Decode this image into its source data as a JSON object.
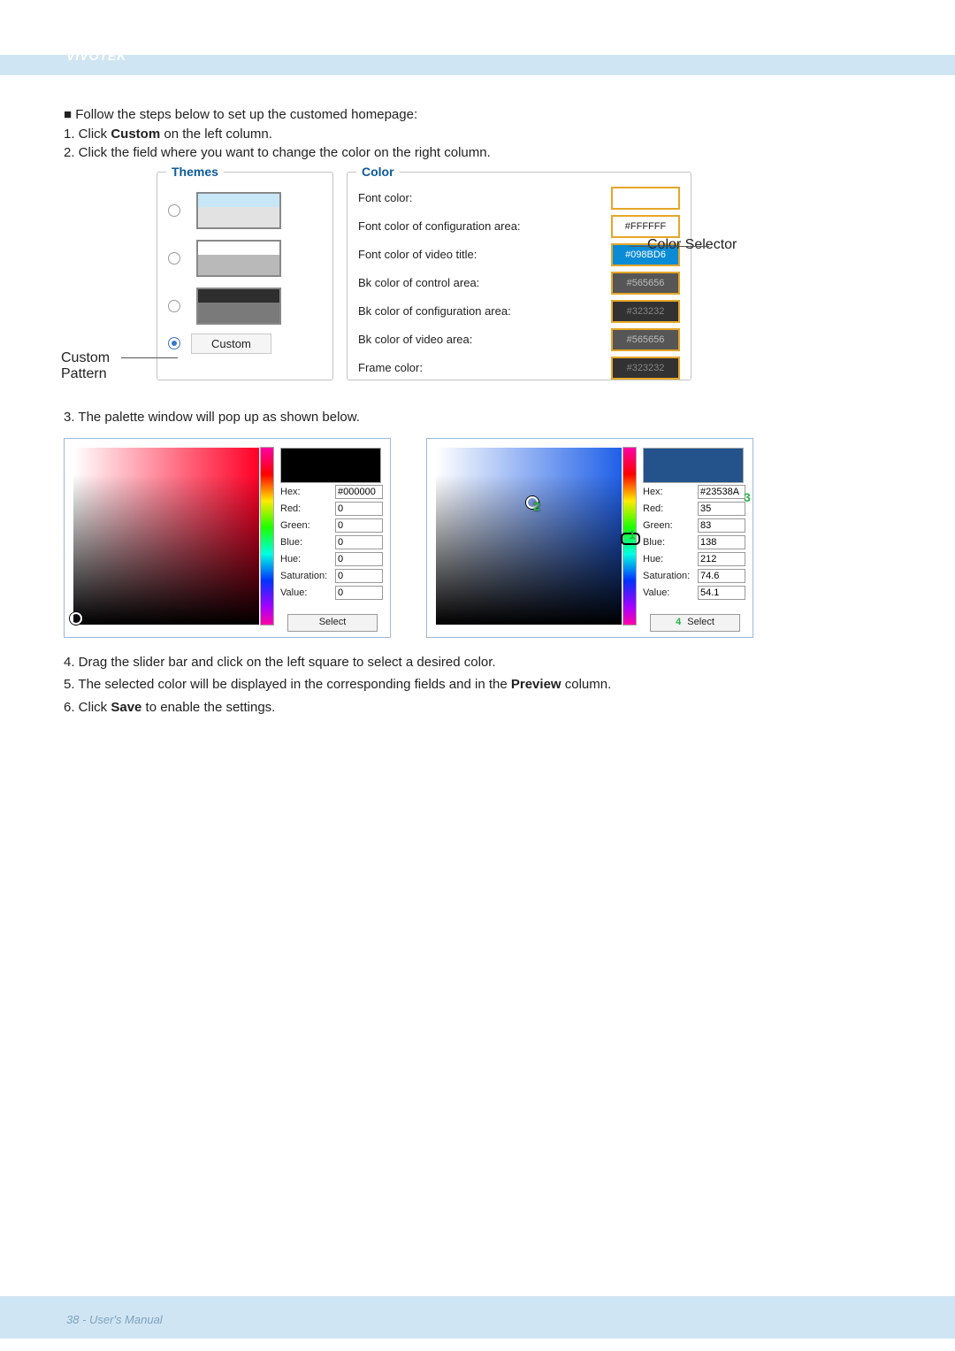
{
  "brand": "VIVOTEK",
  "intro": {
    "bullet": "■ Follow the steps below to set up the customed homepage:",
    "step1_pre": "1. Click ",
    "step1_bold": "Custom",
    "step1_post": " on the left column.",
    "step2": "2. Click the field where you want to change the color on the right column."
  },
  "themes": {
    "title": "Themes",
    "custom_label": "Custom",
    "options": [
      {
        "top": "#c7e7f6",
        "bot": "#e2e2e2"
      },
      {
        "top": "#ffffff",
        "bot": "#b9b9b9"
      },
      {
        "top": "#2e2e2e",
        "bot": "#7a7a7a"
      }
    ]
  },
  "colors": {
    "title": "Color",
    "rows": [
      {
        "lbl": "Font color:",
        "val": "",
        "cls": "empty"
      },
      {
        "lbl": "Font color of configuration area:",
        "val": "#FFFFFF",
        "cls": "white"
      },
      {
        "lbl": "Font color of video title:",
        "val": "#098BD6",
        "cls": "teal"
      },
      {
        "lbl": "Bk color of control area:",
        "val": "#565656",
        "cls": "dk1"
      },
      {
        "lbl": "Bk color of configuration area:",
        "val": "#323232",
        "cls": "dk2"
      },
      {
        "lbl": "Bk color of video area:",
        "val": "#565656",
        "cls": "dk1"
      },
      {
        "lbl": "Frame color:",
        "val": "#323232",
        "cls": "dk2"
      }
    ]
  },
  "annotations": {
    "custom_pattern": "Custom Pattern",
    "color_selector": "Color Selector"
  },
  "step3": "3. The palette window will pop up as shown below.",
  "palette_labels": {
    "hex": "Hex:",
    "red": "Red:",
    "green": "Green:",
    "blue": "Blue:",
    "hue": "Hue:",
    "sat": "Saturation:",
    "val": "Value:",
    "select": "Select"
  },
  "paletteA": {
    "hex": "#000000",
    "red": "0",
    "green": "0",
    "blue": "0",
    "hue": "0",
    "sat": "0",
    "val": "0"
  },
  "paletteB": {
    "hex": "#23538A",
    "red": "35",
    "green": "83",
    "blue": "138",
    "hue": "212",
    "sat": "74.6",
    "val": "54.1"
  },
  "markers": {
    "m1": "1",
    "m2": "2",
    "m3": "3",
    "m4": "4"
  },
  "rest": {
    "s4": "4. Drag the slider bar and click on the left square to select a desired color.",
    "s5_pre": "5. The selected color will be displayed in the corresponding fields and in the ",
    "s5_bold": "Preview",
    "s5_post": " column.",
    "s6_pre": "6. Click ",
    "s6_bold": "Save",
    "s6_post": " to enable the settings."
  },
  "footer": "38 - User's Manual"
}
